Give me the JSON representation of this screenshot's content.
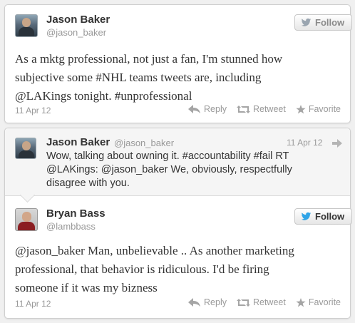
{
  "tweet1": {
    "name": "Jason Baker",
    "handle": "@jason_baker",
    "follow_label": "Follow",
    "text_lines": [
      "As a mktg professional, not just a fan, I'm stunned how",
      "subjective some #NHL teams tweets are, including",
      "@LAKings tonight. #unprofessional"
    ],
    "date": "11 Apr 12",
    "actions": {
      "reply": "Reply",
      "retweet": "Retweet",
      "favorite": "Favorite"
    }
  },
  "tweet2": {
    "quoted": {
      "name": "Jason Baker",
      "handle": "@jason_baker",
      "date": "11 Apr 12",
      "text_lines": [
        "Wow, talking about owning it. #accountability #fail RT",
        "@LAKings: @jason_baker We, obviously, respectfully",
        "disagree with you."
      ]
    },
    "name": "Bryan Bass",
    "handle": "@lambbass",
    "follow_label": "Follow",
    "text_lines": [
      "@jason_baker Man, unbelievable .. As another marketing",
      "professional, that behavior is ridiculous. I'd be firing",
      "someone if it was my bizness"
    ],
    "date": "11 Apr 12",
    "actions": {
      "reply": "Reply",
      "retweet": "Retweet",
      "favorite": "Favorite"
    }
  },
  "colors": {
    "twitter_blue": "#2fa4e7",
    "muted_gray": "#999999",
    "text": "#333333"
  }
}
